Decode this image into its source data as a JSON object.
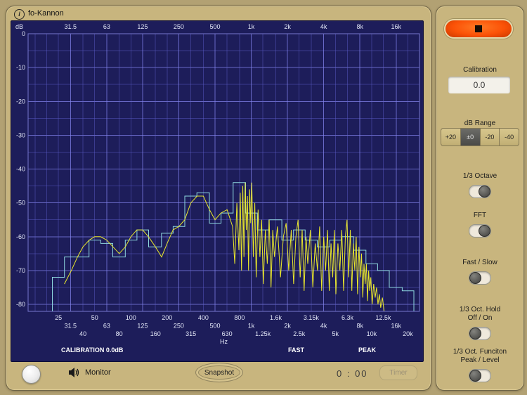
{
  "window": {
    "title": "fo-Kannon",
    "info_icon": "i"
  },
  "colors": {
    "panel": "#c8b57e",
    "plot_bg": "#1d1d5a",
    "grid_minor": "rgba(95,95,205,0.45)",
    "grid_major": "rgba(130,130,235,0.75)",
    "third_octave": "#8fd8df",
    "fft": "#e9e72c",
    "record_button": "#fb5207"
  },
  "plot_annotations": {
    "db_label": "dB",
    "hz_label": "Hz",
    "calibration": "CALIBRATION 0.0dB",
    "speed": "FAST",
    "mode": "PEAK"
  },
  "bottom_bar": {
    "monitor_label": "Monitor",
    "snapshot_label": "Snapshot",
    "timer_value": "0 : 00",
    "timer_button": "Timer"
  },
  "side_panel": {
    "calibration": {
      "label": "Calibration",
      "value": "0.0"
    },
    "db_range": {
      "label": "dB Range",
      "options": [
        "+20",
        "±0",
        "-20",
        "-40"
      ],
      "selected": "±0"
    },
    "toggles": [
      {
        "label": "1/3 Octave",
        "lines": [
          "1/3 Octave"
        ],
        "state": "right"
      },
      {
        "label": "FFT",
        "lines": [
          "FFT"
        ],
        "state": "right"
      },
      {
        "label": "Fast / Slow",
        "lines": [
          "Fast / Slow"
        ],
        "state": "left"
      },
      {
        "label": "1/3 Oct. Hold Off / On",
        "lines": [
          "1/3 Oct. Hold",
          "Off / On"
        ],
        "state": "left"
      },
      {
        "label": "1/3 Oct. Funciton Peak / Level",
        "lines": [
          "1/3 Oct. Funciton",
          "Peak / Level"
        ],
        "state": "left"
      }
    ]
  },
  "chart_data": {
    "type": "line",
    "x_scale": "log",
    "fmin": 14,
    "fmax": 25000,
    "xlabel": "Hz",
    "ylabel": "dB",
    "ylim": [
      -82,
      0
    ],
    "grid": true,
    "db_ticks": [
      0,
      -10,
      -20,
      -30,
      -40,
      -50,
      -60,
      -70,
      -80
    ],
    "top_ticks": [
      {
        "f": 31.5,
        "label": "31.5"
      },
      {
        "f": 63,
        "label": "63"
      },
      {
        "f": 125,
        "label": "125"
      },
      {
        "f": 250,
        "label": "250"
      },
      {
        "f": 500,
        "label": "500"
      },
      {
        "f": 1000,
        "label": "1k"
      },
      {
        "f": 2000,
        "label": "2k"
      },
      {
        "f": 4000,
        "label": "4k"
      },
      {
        "f": 8000,
        "label": "8k"
      },
      {
        "f": 16000,
        "label": "16k"
      }
    ],
    "bottom_ticks": [
      [
        "25",
        25
      ],
      [
        "31.5",
        31.5
      ],
      [
        "40",
        40
      ],
      [
        "50",
        50
      ],
      [
        "63",
        63
      ],
      [
        "80",
        80
      ],
      [
        "100",
        100
      ],
      [
        "125",
        125
      ],
      [
        "160",
        160
      ],
      [
        "200",
        200
      ],
      [
        "250",
        250
      ],
      [
        "315",
        315
      ],
      [
        "400",
        400
      ],
      [
        "500",
        500
      ],
      [
        "630",
        630
      ],
      [
        "800",
        800
      ],
      [
        "1k",
        1000
      ],
      [
        "1.25k",
        1250
      ],
      [
        "1.6k",
        1600
      ],
      [
        "2k",
        2000
      ],
      [
        "2.5k",
        2500
      ],
      [
        "3.15k",
        3150
      ],
      [
        "4k",
        4000
      ],
      [
        "5k",
        5000
      ],
      [
        "6.3k",
        6300
      ],
      [
        "8k",
        8000
      ],
      [
        "10k",
        10000
      ],
      [
        "12.5k",
        12500
      ],
      [
        "16k",
        16000
      ],
      [
        "20k",
        20000
      ]
    ],
    "grid_freqs": [
      16,
      20,
      25,
      31.5,
      40,
      50,
      63,
      80,
      100,
      125,
      160,
      200,
      250,
      315,
      400,
      500,
      630,
      800,
      1000,
      1250,
      1600,
      2000,
      2500,
      3150,
      4000,
      5000,
      6300,
      8000,
      10000,
      12500,
      16000,
      20000,
      25000
    ],
    "octave_freqs": [
      31.5,
      63,
      125,
      250,
      500,
      1000,
      2000,
      4000,
      8000,
      16000
    ],
    "series": [
      {
        "name": "third-octave-bands",
        "style": "step",
        "color": "#8fd8df",
        "freqs": [
          25,
          31.5,
          40,
          50,
          63,
          80,
          100,
          125,
          160,
          200,
          250,
          315,
          400,
          500,
          630,
          800,
          1000,
          1250,
          1600,
          2000,
          2500,
          3150,
          4000,
          5000,
          6300,
          8000,
          10000,
          12500,
          16000,
          20000
        ],
        "values_db": [
          -72,
          -66,
          -66,
          -61,
          -62,
          -66,
          -61,
          -58,
          -63,
          -59,
          -57,
          -48,
          -47,
          -56,
          -53,
          -44,
          -53,
          -58,
          -55,
          -61,
          -58,
          -61,
          -63,
          -61,
          -60,
          -64,
          -68,
          -70,
          -75,
          -76
        ]
      },
      {
        "name": "fft-spectrum",
        "style": "line",
        "color": "#e9e72c",
        "points": [
          [
            28,
            -74
          ],
          [
            32,
            -70
          ],
          [
            36,
            -66
          ],
          [
            40,
            -63
          ],
          [
            45,
            -61
          ],
          [
            50,
            -60
          ],
          [
            56,
            -60
          ],
          [
            63,
            -61
          ],
          [
            71,
            -63
          ],
          [
            80,
            -65
          ],
          [
            90,
            -63
          ],
          [
            100,
            -60
          ],
          [
            112,
            -58
          ],
          [
            125,
            -58
          ],
          [
            140,
            -60
          ],
          [
            160,
            -63
          ],
          [
            180,
            -66
          ],
          [
            200,
            -62
          ],
          [
            224,
            -58
          ],
          [
            250,
            -57
          ],
          [
            280,
            -55
          ],
          [
            315,
            -50
          ],
          [
            355,
            -48
          ],
          [
            400,
            -48
          ],
          [
            450,
            -52
          ],
          [
            500,
            -55
          ],
          [
            560,
            -53
          ],
          [
            630,
            -52
          ],
          [
            700,
            -57
          ],
          [
            730,
            -68
          ],
          [
            760,
            -50
          ],
          [
            790,
            -64
          ],
          [
            810,
            -47
          ],
          [
            830,
            -70
          ],
          [
            850,
            -45
          ],
          [
            870,
            -66
          ],
          [
            890,
            -44
          ],
          [
            910,
            -58
          ],
          [
            930,
            -48
          ],
          [
            950,
            -70
          ],
          [
            970,
            -46
          ],
          [
            990,
            -56
          ],
          [
            1010,
            -44
          ],
          [
            1040,
            -66
          ],
          [
            1070,
            -50
          ],
          [
            1100,
            -72
          ],
          [
            1140,
            -52
          ],
          [
            1180,
            -66
          ],
          [
            1220,
            -55
          ],
          [
            1260,
            -74
          ],
          [
            1310,
            -58
          ],
          [
            1360,
            -68
          ],
          [
            1410,
            -55
          ],
          [
            1460,
            -75
          ],
          [
            1510,
            -58
          ],
          [
            1560,
            -66
          ],
          [
            1650,
            -57
          ],
          [
            1750,
            -72
          ],
          [
            1850,
            -60
          ],
          [
            1950,
            -56
          ],
          [
            2050,
            -70
          ],
          [
            2150,
            -58
          ],
          [
            2250,
            -74
          ],
          [
            2350,
            -60
          ],
          [
            2450,
            -55
          ],
          [
            2550,
            -72
          ],
          [
            2650,
            -58
          ],
          [
            2750,
            -76
          ],
          [
            2850,
            -60
          ],
          [
            2950,
            -68
          ],
          [
            3100,
            -58
          ],
          [
            3250,
            -75
          ],
          [
            3400,
            -62
          ],
          [
            3550,
            -70
          ],
          [
            3700,
            -57
          ],
          [
            3850,
            -76
          ],
          [
            4000,
            -60
          ],
          [
            4150,
            -70
          ],
          [
            4300,
            -58
          ],
          [
            4450,
            -76
          ],
          [
            4600,
            -62
          ],
          [
            4750,
            -72
          ],
          [
            4900,
            -58
          ],
          [
            5050,
            -77
          ],
          [
            5250,
            -62
          ],
          [
            5450,
            -70
          ],
          [
            5650,
            -58
          ],
          [
            5850,
            -76
          ],
          [
            6050,
            -60
          ],
          [
            6250,
            -55
          ],
          [
            6450,
            -72
          ],
          [
            6650,
            -58
          ],
          [
            6850,
            -76
          ],
          [
            7050,
            -62
          ],
          [
            7250,
            -70
          ],
          [
            7450,
            -60
          ],
          [
            7650,
            -77
          ],
          [
            7850,
            -63
          ],
          [
            8050,
            -72
          ],
          [
            8250,
            -65
          ],
          [
            8450,
            -78
          ],
          [
            8650,
            -68
          ],
          [
            8850,
            -74
          ],
          [
            9050,
            -68
          ],
          [
            9250,
            -79
          ],
          [
            9450,
            -70
          ],
          [
            9650,
            -76
          ],
          [
            9850,
            -72
          ],
          [
            10100,
            -80
          ],
          [
            10400,
            -74
          ],
          [
            10700,
            -78
          ],
          [
            11000,
            -75
          ],
          [
            11300,
            -80
          ],
          [
            11600,
            -77
          ],
          [
            11900,
            -81
          ],
          [
            12300,
            -78
          ],
          [
            12700,
            -82
          ]
        ]
      }
    ]
  }
}
